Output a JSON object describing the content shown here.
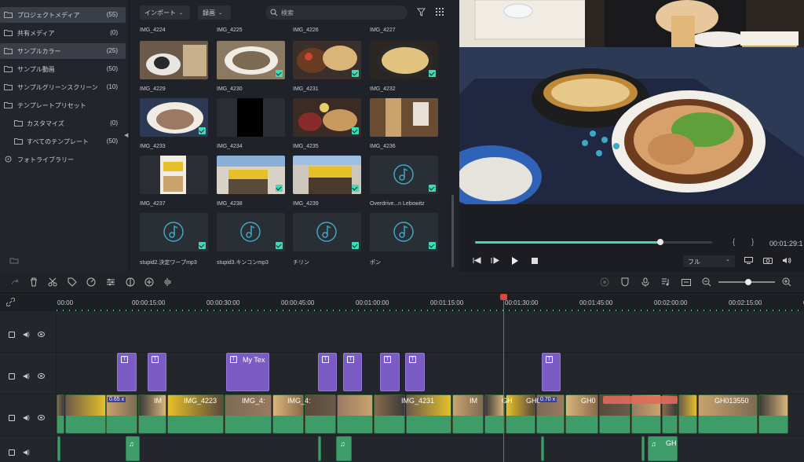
{
  "library": {
    "items": [
      {
        "label": "プロジェクトメディア",
        "count": "(55)",
        "selected": true,
        "sub": false
      },
      {
        "label": "共有メディア",
        "count": "(0)",
        "selected": false,
        "sub": false
      },
      {
        "label": "サンプルカラー",
        "count": "(25)",
        "selected": true,
        "sub": false
      },
      {
        "label": "サンプル動画",
        "count": "(50)",
        "selected": false,
        "sub": false
      },
      {
        "label": "サンプルグリーンスクリーン",
        "count": "(10)",
        "selected": false,
        "sub": false
      },
      {
        "label": "テンプレートプリセット",
        "count": "",
        "selected": false,
        "sub": false
      },
      {
        "label": "カスタマイズ",
        "count": "(0)",
        "selected": false,
        "sub": true
      },
      {
        "label": "すべてのテンプレート",
        "count": "(50)",
        "selected": false,
        "sub": true
      },
      {
        "label": "フォトライブラリー",
        "count": "",
        "selected": false,
        "sub": false
      }
    ]
  },
  "media": {
    "import_label": "インポート",
    "record_label": "録画",
    "search_placeholder": "検索",
    "header_names": [
      "IMG_4224",
      "IMG_4225",
      "IMG_4226",
      "IMG_4227"
    ],
    "rows": [
      [
        {
          "name": "IMG_4229",
          "kind": "food1",
          "check": false
        },
        {
          "name": "IMG_4230",
          "kind": "food2",
          "check": true
        },
        {
          "name": "IMG_4231",
          "kind": "food3",
          "check": true
        },
        {
          "name": "IMG_4232",
          "kind": "food4",
          "check": true
        }
      ],
      [
        {
          "name": "IMG_4233",
          "kind": "food5",
          "check": true
        },
        {
          "name": "IMG_4234",
          "kind": "black",
          "check": false
        },
        {
          "name": "IMG_4235",
          "kind": "food6",
          "check": true
        },
        {
          "name": "IMG_4236",
          "kind": "food7",
          "check": false
        }
      ],
      [
        {
          "name": "IMG_4237",
          "kind": "shop1",
          "check": false
        },
        {
          "name": "IMG_4238",
          "kind": "shop2",
          "check": true
        },
        {
          "name": "IMG_4239",
          "kind": "shop3",
          "check": true
        },
        {
          "name": "Overdrive...n Lebowitz",
          "kind": "audio",
          "check": true
        }
      ],
      [
        {
          "name": "stupid2.決定ワープmp3",
          "kind": "audio",
          "check": true
        },
        {
          "name": "stupid3.キンコンmp3",
          "kind": "audio",
          "check": true
        },
        {
          "name": "チリン",
          "kind": "audio",
          "check": true
        },
        {
          "name": "ポン",
          "kind": "audio",
          "check": true
        }
      ]
    ]
  },
  "preview": {
    "timecode": "00:01:29:1",
    "quality": "フル",
    "progress": 0.78,
    "bracket_in": "{",
    "bracket_out": "}"
  },
  "timeline": {
    "ruler": [
      "00:00",
      "00:00:15:00",
      "00:00:30:00",
      "00:00:45:00",
      "00:01:00:00",
      "00:01:15:00",
      "00:01:30:00",
      "00:01:45:00",
      "00:02:00:00",
      "00:02:15:00",
      "00:02"
    ],
    "playhead_label": "00:01:30:00",
    "title_clips": [
      {
        "label": ""
      },
      {
        "label": ""
      },
      {
        "label": "My Tex"
      },
      {
        "label": ""
      },
      {
        "label": ""
      },
      {
        "label": ""
      },
      {
        "label": ""
      },
      {
        "label": ""
      }
    ],
    "video_labels": [
      "0.65 x",
      "IM",
      "IMG_4223",
      "IMG_4:",
      "IMG_4:",
      "IMG_4231",
      "IM",
      "GH",
      "GH0",
      "0.70 x",
      "GH0",
      "GH013550"
    ],
    "audio_labels": [
      "GH"
    ]
  },
  "colors": {
    "accent": "#3fdbb9",
    "title_clip": "#7b5cc4",
    "video_clip": "#3e9c68",
    "playhead": "#e0443b"
  }
}
